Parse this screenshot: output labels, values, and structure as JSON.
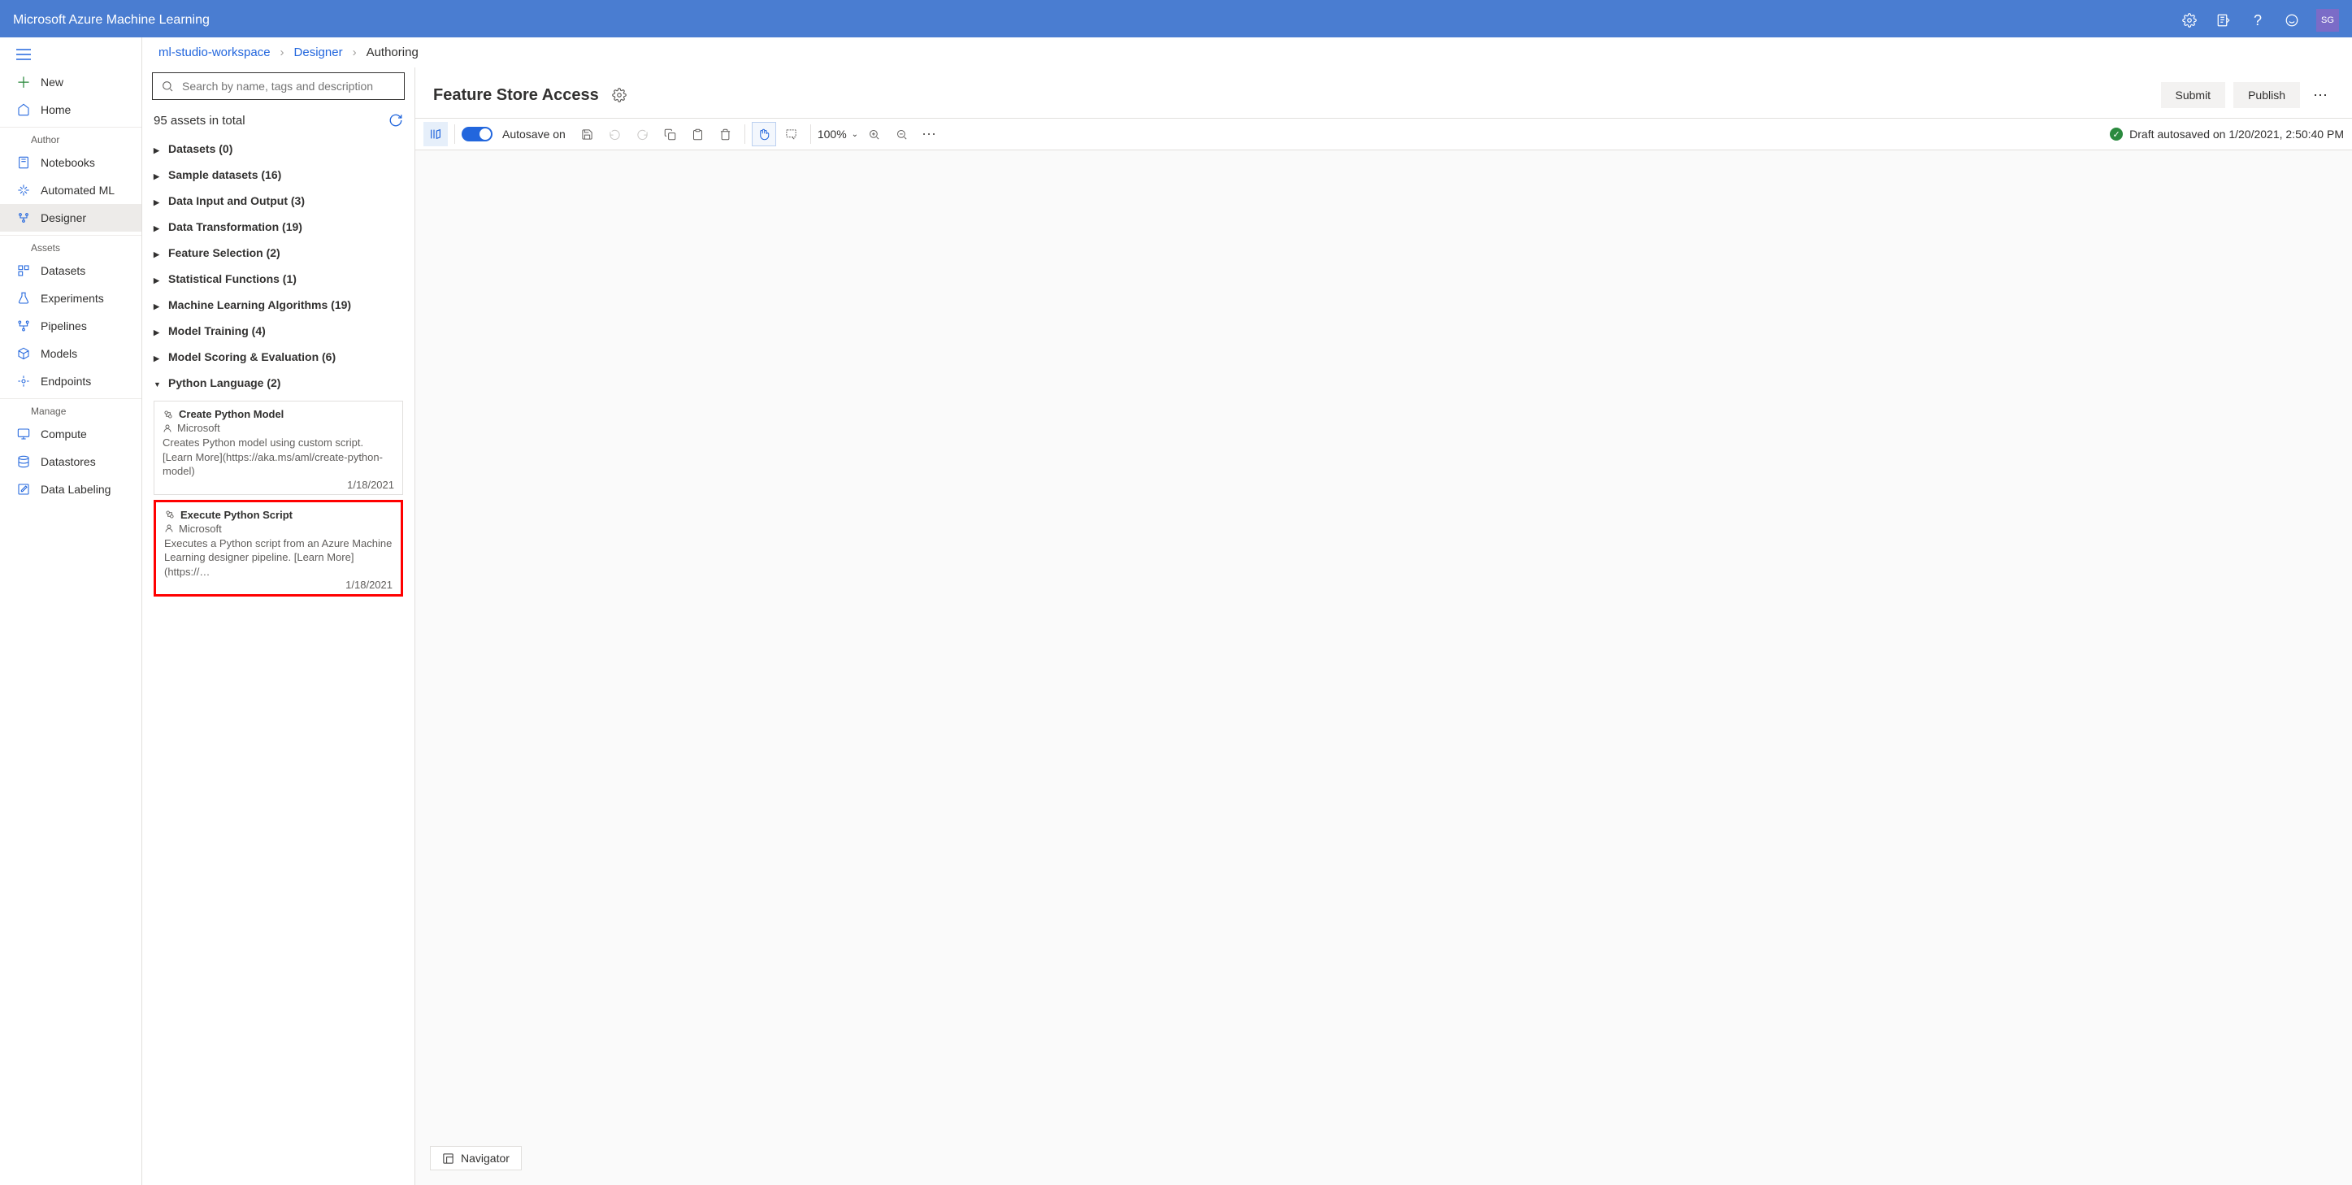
{
  "topbar": {
    "title": "Microsoft Azure Machine Learning",
    "user_initials": "SG"
  },
  "leftnav": {
    "new": "New",
    "home": "Home",
    "sections": {
      "author": {
        "label": "Author",
        "items": {
          "notebooks": "Notebooks",
          "automl": "Automated ML",
          "designer": "Designer"
        }
      },
      "assets": {
        "label": "Assets",
        "items": {
          "datasets": "Datasets",
          "experiments": "Experiments",
          "pipelines": "Pipelines",
          "models": "Models",
          "endpoints": "Endpoints"
        }
      },
      "manage": {
        "label": "Manage",
        "items": {
          "compute": "Compute",
          "datastores": "Datastores",
          "datalabeling": "Data Labeling"
        }
      }
    }
  },
  "breadcrumb": {
    "workspace": "ml-studio-workspace",
    "designer": "Designer",
    "current": "Authoring"
  },
  "assetpanel": {
    "search_placeholder": "Search by name, tags and description",
    "count_text": "95 assets in total",
    "groups": {
      "datasets": "Datasets (0)",
      "sample": "Sample datasets (16)",
      "dataio": "Data Input and Output (3)",
      "datatrans": "Data Transformation (19)",
      "featuresel": "Feature Selection (2)",
      "statfunc": "Statistical Functions (1)",
      "mlalg": "Machine Learning Algorithms (19)",
      "modeltrain": "Model Training (4)",
      "modelscore": "Model Scoring & Evaluation (6)",
      "python": "Python Language (2)"
    },
    "modules": {
      "create_python": {
        "title": "Create Python Model",
        "author": "Microsoft",
        "desc": "Creates Python model using custom script. [Learn More](https://aka.ms/aml/create-python-model)",
        "date": "1/18/2021"
      },
      "exec_python": {
        "title": "Execute Python Script",
        "author": "Microsoft",
        "desc": "Executes a Python script from an Azure Machine Learning designer pipeline. [Learn More](https://…",
        "date": "1/18/2021"
      }
    }
  },
  "canvas": {
    "title": "Feature Store Access",
    "submit": "Submit",
    "publish": "Publish",
    "autosave_label": "Autosave on",
    "zoom": "100%",
    "status": "Draft autosaved on 1/20/2021, 2:50:40 PM",
    "navigator": "Navigator"
  }
}
